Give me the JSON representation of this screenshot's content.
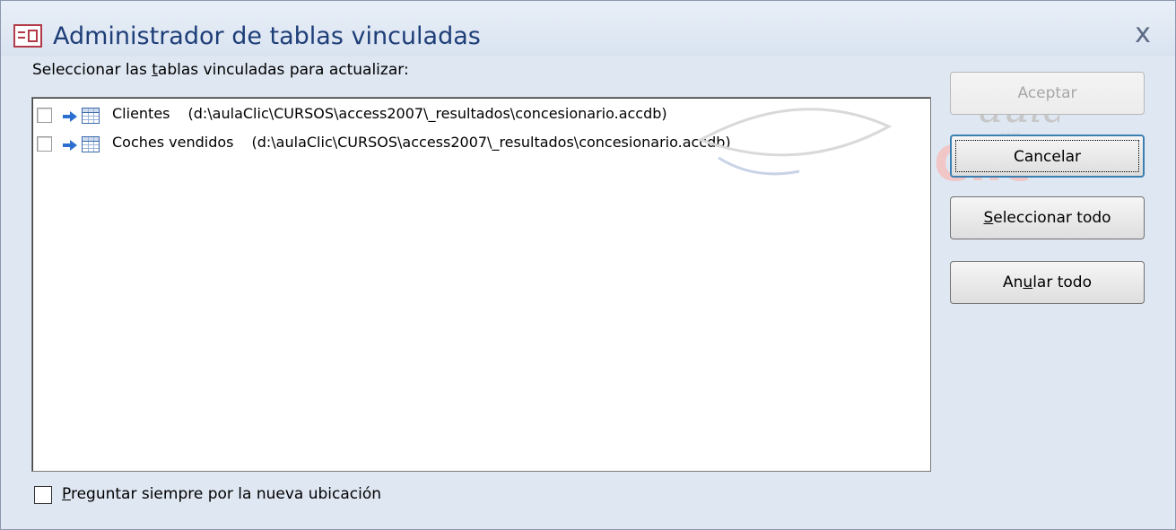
{
  "window": {
    "title": "Administrador de tablas vinculadas",
    "close_glyph": "x"
  },
  "instruction": {
    "before": "Seleccionar las ",
    "underlined": "t",
    "after": "ablas vinculadas para actualizar:"
  },
  "tables": [
    {
      "name": "Clientes",
      "path": "(d:\\aulaClic\\CURSOS\\access2007\\_resultados\\concesionario.accdb)",
      "checked": false
    },
    {
      "name": "Coches vendidos",
      "path": "(d:\\aulaClic\\CURSOS\\access2007\\_resultados\\concesionario.accdb)",
      "checked": false
    }
  ],
  "buttons": {
    "aceptar": {
      "label": "Aceptar",
      "enabled": false
    },
    "cancelar": {
      "label": "Cancelar"
    },
    "seleccionar": {
      "underlined": "S",
      "rest": "eleccionar todo"
    },
    "anular": {
      "before": "An",
      "underlined": "u",
      "after": "lar todo"
    }
  },
  "footer": {
    "checkbox_checked": false,
    "label_underlined": "P",
    "label_rest": "reguntar siempre por la nueva ubicación"
  },
  "watermark": {
    "line1": "aula",
    "line2": "Clic",
    "suffix": ".com"
  },
  "colors": {
    "title": "#1e3e78",
    "dialog_bg": "#dfe7f2",
    "default_button_border": "#3c7fb1",
    "app_icon": "#b23a48"
  }
}
